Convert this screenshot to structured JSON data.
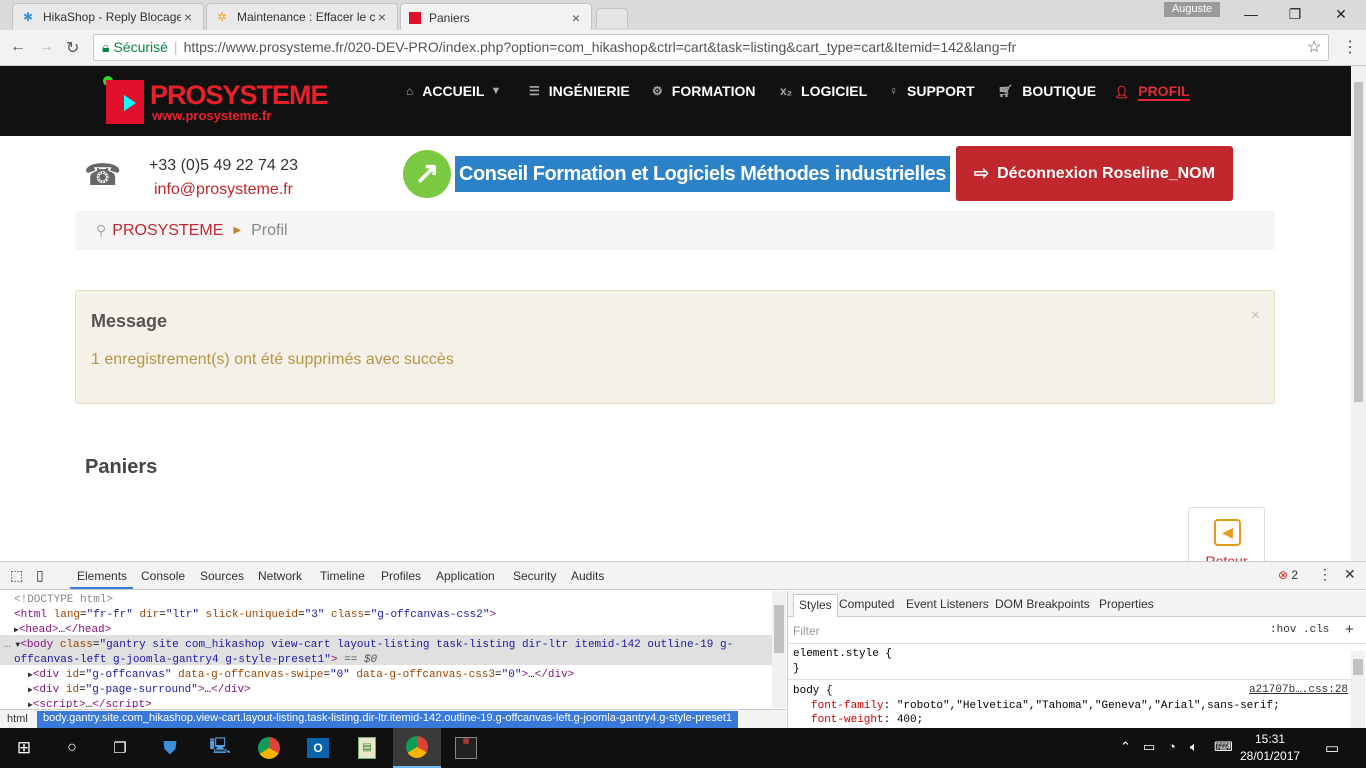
{
  "browser": {
    "tabs": [
      {
        "label": "HikaShop - Reply Blocage",
        "icon": "hikashop-icon"
      },
      {
        "label": "Maintenance : Effacer le c",
        "icon": "joomla-icon"
      },
      {
        "label": "Paniers",
        "icon": "prosysteme-icon"
      }
    ],
    "user_chip": "Auguste",
    "secure_label": "Sécurisé",
    "url": "https://www.prosysteme.fr/020-DEV-PRO/index.php?option=com_hikashop&ctrl=cart&task=listing&cart_type=cart&Itemid=142&lang=fr"
  },
  "site": {
    "logo_text": "PROSYSTEME",
    "logo_url": "www.prosysteme.fr",
    "menu": [
      {
        "label": "ACCUEIL",
        "icon": "home-icon",
        "dropdown": true
      },
      {
        "label": "INGÉNIERIE",
        "icon": "list-icon"
      },
      {
        "label": "FORMATION",
        "icon": "cogs-icon"
      },
      {
        "label": "LOGICIEL",
        "icon": "subscript-icon"
      },
      {
        "label": "SUPPORT",
        "icon": "lightbulb-icon"
      },
      {
        "label": "BOUTIQUE",
        "icon": "cart-icon"
      },
      {
        "label": "PROFIL",
        "icon": "user-icon",
        "active": true
      }
    ],
    "phone": "+33 (0)5 49 22 74 23",
    "email": "info@prosysteme.fr",
    "banner_text": "Conseil Formation et Logiciels Méthodes industrielles",
    "logout_label": "Déconnexion Roseline_NOM",
    "breadcrumb": {
      "home": "PROSYSTEME",
      "current": "Profil"
    },
    "alert": {
      "title": "Message",
      "text": "1 enregistrement(s) ont été supprimés avec succès",
      "close": "×"
    },
    "page_title": "Paniers",
    "retour_label": "Retour"
  },
  "devtools": {
    "tabs": [
      "Elements",
      "Console",
      "Sources",
      "Network",
      "Timeline",
      "Profiles",
      "Application",
      "Security",
      "Audits"
    ],
    "error_count": "2",
    "dom": {
      "doctype": "<!DOCTYPE html>",
      "html_lang": "fr-fr",
      "html_dir": "ltr",
      "html_slick": "3",
      "html_class": "g-offcanvas-css2",
      "body_class_1": "gantry site com_hikashop view-cart layout-listing task-listing dir-ltr itemid-142 outline-19 g-",
      "body_class_2": "offcanvas-left g-joomla-gantry4 g-style-preset1",
      "div1_id": "g-offcanvas",
      "div1_swipe": "0",
      "div1_css3": "0",
      "div2_id": "g-page-surround"
    },
    "crumb_html": "html",
    "crumb_body": "body.gantry.site.com_hikashop.view-cart.layout-listing.task-listing.dir-ltr.itemid-142.outline-19.g-offcanvas-left.g-joomla-gantry4.g-style-preset1",
    "styles_tabs": [
      "Styles",
      "Computed",
      "Event Listeners",
      "DOM Breakpoints",
      "Properties"
    ],
    "filter_placeholder": "Filter",
    "hov_cls": ":hov  .cls",
    "element_style": "element.style {",
    "close_brace": "}",
    "body_selector": "body {",
    "source_link": "a21707b….css:28",
    "font_family_prop": "font-family",
    "font_family_val": "\"roboto\",\"Helvetica\",\"Tahoma\",\"Geneva\",\"Arial\",sans-serif;",
    "font_weight_prop": "font-weight",
    "font_weight_val": "400;"
  },
  "taskbar": {
    "time": "15:31",
    "date": "28/01/2017"
  }
}
